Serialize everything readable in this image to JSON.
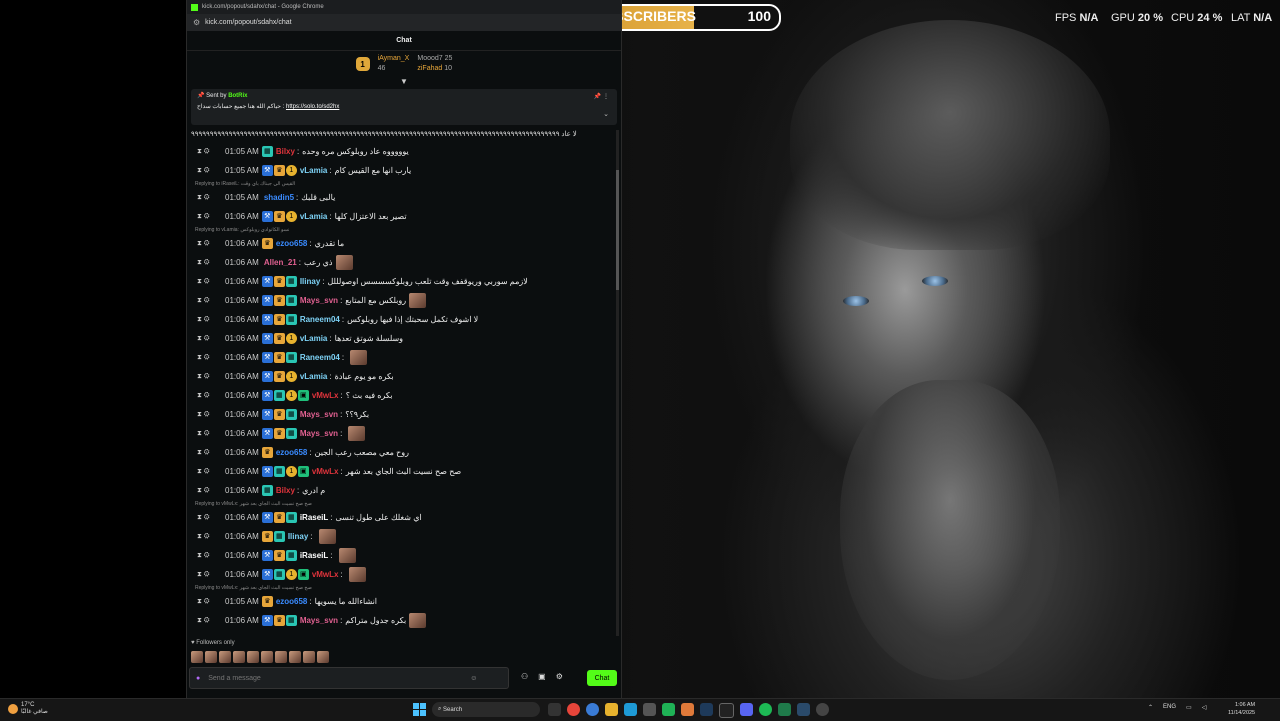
{
  "window": {
    "title": "kick.com/popout/sdahx/chat - Google Chrome",
    "url": "kick.com/popout/sdahx/chat"
  },
  "subs": {
    "current": "69",
    "label": "SUBSCRIBERS",
    "goal": "100",
    "progress": 0.69,
    "color": "#e7b24a"
  },
  "hud": {
    "fps_label": "FPS",
    "fps": "N/A",
    "gpu_label": "GPU",
    "gpu": "20 %",
    "cpu_label": "CPU",
    "cpu": "24 %",
    "lat_label": "LAT",
    "lat": "N/A"
  },
  "chat": {
    "header": "Chat",
    "leaderboard": {
      "first_rank": "1",
      "first_name": "iAyman_X",
      "first_count": "46",
      "second_name": "Moood7",
      "second_count": "25",
      "third_name": "ziFahad",
      "third_count": "10"
    },
    "pinned": {
      "sent_by_label": "Sent by",
      "bot": "BotRix",
      "text": "حياكم الله هنا جميع حسابات سداح",
      "link": "https://solo.to/sd2hx"
    },
    "top_line": "لا عاد ٩٩٩٩٩٩٩٩٩٩٩٩٩٩٩٩٩٩٩٩٩٩٩٩٩٩٩٩٩٩٩٩٩٩٩٩٩٩٩٩٩٩٩٩٩٩٩٩٩٩٩٩٩٩٩٩٩٩٩٩٩٩٩٩٩٩٩٩٩٩٩٩٩٩٩٩٩٩٩٩٩٩٩٩٩٩٩٩٩٩٩٩٩٩٩٩٩٩",
    "followers_label": "Followers only",
    "input_placeholder": "Send a message",
    "send_label": "Chat"
  },
  "messages": [
    {
      "time": "01:05 AM",
      "badges": [
        "vip"
      ],
      "user": "Bilxy",
      "color": "#e0343c",
      "text": "يوووووه عاد روبلوكس مره وحده",
      "emote": false
    },
    {
      "time": "01:05 AM",
      "badges": [
        "mod",
        "crown",
        "sub"
      ],
      "user": "vLamia",
      "color": "#7ed3f7",
      "text": "يارب انها مع القيس كام",
      "emote": false
    },
    {
      "reply": "Replying to iRaseiL: القيس الي جبناك باي وقت"
    },
    {
      "time": "01:05 AM",
      "badges": [],
      "user": "shadin5",
      "color": "#3a8bff",
      "text": "يالبى قلبك",
      "emote": false
    },
    {
      "time": "01:06 AM",
      "badges": [
        "mod",
        "crown",
        "sub"
      ],
      "user": "vLamia",
      "color": "#7ed3f7",
      "text": "تصير بعد الاعتزال كلها",
      "emote": false
    },
    {
      "reply": "Replying to vLamia: نسو الكانوادي روبلوكس"
    },
    {
      "time": "01:06 AM",
      "badges": [
        "crown"
      ],
      "user": "ezoo658",
      "color": "#3a8bff",
      "text": "ما تقدري",
      "emote": false
    },
    {
      "time": "01:06 AM",
      "badges": [],
      "user": "Allen_21",
      "color": "#e06090",
      "text": "ذي رعب",
      "emote": true
    },
    {
      "time": "01:06 AM",
      "badges": [
        "mod",
        "crown",
        "vip"
      ],
      "user": "Ilinay",
      "color": "#7ed3f7",
      "text": "لازمم سوربي وريوقفف وقت تلعب روبلوكسسسس اوصولللل",
      "emote": false
    },
    {
      "time": "01:06 AM",
      "badges": [
        "mod",
        "crown",
        "vip"
      ],
      "user": "Mays_svn",
      "color": "#e06090",
      "text": "روبلكس مع المتابع",
      "emote": true
    },
    {
      "time": "01:06 AM",
      "badges": [
        "mod",
        "crown",
        "vip"
      ],
      "user": "Raneem04",
      "color": "#7ed3f7",
      "text": "لا اشوف تكمل سحبتك إذا فيها روبلوكس",
      "emote": false
    },
    {
      "time": "01:06 AM",
      "badges": [
        "mod",
        "crown",
        "sub"
      ],
      "user": "vLamia",
      "color": "#7ed3f7",
      "text": "وسلسلة شوتق تعدها",
      "emote": false
    },
    {
      "time": "01:06 AM",
      "badges": [
        "mod",
        "crown",
        "vip"
      ],
      "user": "Raneem04",
      "color": "#7ed3f7",
      "text": "",
      "emote": true
    },
    {
      "time": "01:06 AM",
      "badges": [
        "mod",
        "crown",
        "sub"
      ],
      "user": "vLamia",
      "color": "#7ed3f7",
      "text": "بكره مو يوم عبادة",
      "emote": false
    },
    {
      "time": "01:06 AM",
      "badges": [
        "mod",
        "vip",
        "sub",
        "gift"
      ],
      "user": "vMwLx",
      "color": "#e0343c",
      "text": "بكره فيه بث ؟",
      "emote": false
    },
    {
      "time": "01:06 AM",
      "badges": [
        "mod",
        "crown",
        "vip"
      ],
      "user": "Mays_svn",
      "color": "#e06090",
      "text": "بكر٩؟؟",
      "emote": false
    },
    {
      "time": "01:06 AM",
      "badges": [
        "mod",
        "crown",
        "vip"
      ],
      "user": "Mays_svn",
      "color": "#e06090",
      "text": "",
      "emote": true
    },
    {
      "time": "01:06 AM",
      "badges": [
        "crown"
      ],
      "user": "ezoo658",
      "color": "#3a8bff",
      "text": "روح معي مصعب رعب الجين",
      "emote": false
    },
    {
      "time": "01:06 AM",
      "badges": [
        "mod",
        "vip",
        "sub",
        "gift"
      ],
      "user": "vMwLx",
      "color": "#e0343c",
      "text": "صح صح نسيت البث الجاي بعد شهر",
      "emote": false
    },
    {
      "time": "01:06 AM",
      "badges": [
        "vip"
      ],
      "user": "Bilxy",
      "color": "#e0343c",
      "text": "م ادري",
      "emote": false
    },
    {
      "reply": "Replying to vMwLx: صح صح نسيت البث الجاي بعد شهر"
    },
    {
      "time": "01:06 AM",
      "badges": [
        "mod",
        "crown",
        "vip"
      ],
      "user": "iRaseiL",
      "color": "#ffffff",
      "text": "اي شغلك على طول تنسى",
      "emote": false
    },
    {
      "time": "01:06 AM",
      "badges": [
        "crown",
        "vip"
      ],
      "user": "Ilinay",
      "color": "#7ed3f7",
      "text": "",
      "emote": true
    },
    {
      "time": "01:06 AM",
      "badges": [
        "mod",
        "crown",
        "vip"
      ],
      "user": "iRaseiL",
      "color": "#ffffff",
      "text": "",
      "emote": true
    },
    {
      "time": "01:06 AM",
      "badges": [
        "mod",
        "vip",
        "sub",
        "gift"
      ],
      "user": "vMwLx",
      "color": "#e0343c",
      "text": "",
      "emote": true
    },
    {
      "reply": "Replying to vMwLx: صح صح نسيت البث الجاي بعد شهر"
    },
    {
      "time": "01:05 AM",
      "badges": [
        "crown"
      ],
      "user": "ezoo658",
      "color": "#3a8bff",
      "text": "انشاءالله ما يسويها",
      "emote": false
    },
    {
      "time": "01:06 AM",
      "badges": [
        "mod",
        "crown",
        "vip"
      ],
      "user": "Mays_svn",
      "color": "#e06090",
      "text": "بكره جدول متراكم",
      "emote": true
    }
  ],
  "taskbar": {
    "weather_temp": "17°C",
    "weather_text": "صافي غالبًا",
    "search_label": "Search",
    "lang": "ENG",
    "time": "1:06 AM",
    "date": "11/14/2025"
  }
}
